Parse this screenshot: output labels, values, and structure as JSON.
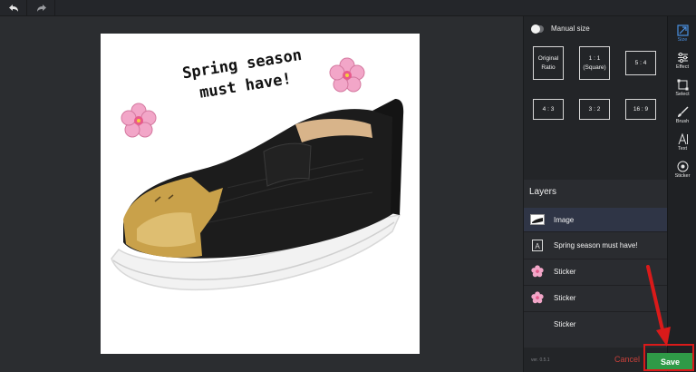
{
  "toolbar": {
    "undo_icon": "undo-arrow-icon",
    "redo_icon": "redo-arrow-icon"
  },
  "canvas": {
    "text_line1": "Spring season",
    "text_line2": "must have!",
    "stickers": [
      "sakura-flower-sticker",
      "sakura-flower-sticker"
    ]
  },
  "panel": {
    "manual_size_label": "Manual size",
    "ratios": [
      {
        "label": "Original\nRatio"
      },
      {
        "label": "1 : 1\n(Square)"
      },
      {
        "label": "5 : 4"
      },
      {
        "label": "4 : 3"
      },
      {
        "label": "3 : 2"
      },
      {
        "label": "16 : 9"
      }
    ],
    "layers_title": "Layers",
    "layers": [
      {
        "label": "Image",
        "icon": "image-thumbnail-icon",
        "active": true
      },
      {
        "label": "Spring season must have!",
        "icon": "text-layer-icon",
        "active": false
      },
      {
        "label": "Sticker",
        "icon": "sakura-sticker-icon",
        "active": false
      },
      {
        "label": "Sticker",
        "icon": "sakura-sticker-icon",
        "active": false
      },
      {
        "label": "Sticker",
        "icon": "",
        "active": false
      }
    ],
    "version": "ver. 0.5.1",
    "cancel_label": "Cancel",
    "save_label": "Save"
  },
  "rail": {
    "tools": [
      {
        "label": "Size",
        "icon": "resize-icon",
        "active": true
      },
      {
        "label": "Effect",
        "icon": "sliders-icon",
        "active": false
      },
      {
        "label": "Select",
        "icon": "crop-select-icon",
        "active": false
      },
      {
        "label": "Brush",
        "icon": "brush-icon",
        "active": false
      },
      {
        "label": "Text",
        "icon": "text-icon",
        "active": false
      },
      {
        "label": "Sticker",
        "icon": "sticker-icon",
        "active": false
      }
    ]
  },
  "colors": {
    "accent": "#4a90e2",
    "save": "#2f9a47",
    "cancel": "#c8403a",
    "highlight": "#d91a1a"
  }
}
